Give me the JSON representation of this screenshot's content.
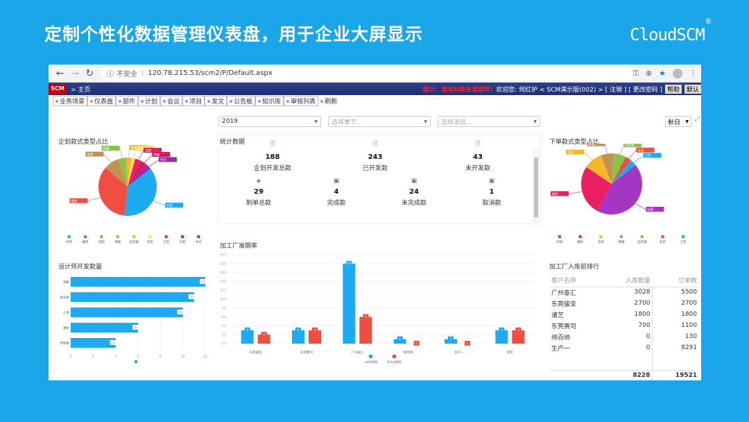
{
  "slide": {
    "title": "定制个性化数据管理仪表盘，用于企业大屏显示",
    "logo": "CloudSCM",
    "logo_mark": "®"
  },
  "browser": {
    "url_insecure": "不安全",
    "url": "120.78.215.53/scm2/P/Default.aspx"
  },
  "app": {
    "logo": "SCM",
    "breadcrumb": "> 主页",
    "warning": "提示：您有N条未读邮件!",
    "welcome": "欢迎您: 何红护 < SCM演示版(002) > [ 注销 ] [ 更改密码 ]",
    "btn_help": "帮助",
    "btn_default": "默认"
  },
  "tabs": [
    "业务场景",
    "仪表盘",
    "部件",
    "计划",
    "会议",
    "项目",
    "发文",
    "公告板",
    "知识库",
    "审核列表"
  ],
  "refresh": "刷新",
  "filters": {
    "year": "2019",
    "season_ph": "选择季节...",
    "wave_ph": "选择波段...",
    "season": "秋日"
  },
  "panels": {
    "plan": "企划款式类型占比",
    "stats": "统计数据",
    "order": "下单款式类型占比",
    "designer": "设计师开发款量",
    "factory": "加工厂准期率",
    "ranking": "加工厂入库前排行"
  },
  "stats": [
    {
      "icon": "🗎",
      "value": "188",
      "label": "企划开发总款"
    },
    {
      "icon": "🗎",
      "value": "243",
      "label": "已开发款"
    },
    {
      "icon": "🗎",
      "value": "43",
      "label": "未开发款"
    },
    {
      "icon": "◈",
      "value": "29",
      "label": "制单总款"
    },
    {
      "icon": "▣",
      "value": "4",
      "label": "完成款"
    },
    {
      "icon": "▣",
      "value": "24",
      "label": "未完成款"
    },
    {
      "icon": "▣",
      "value": "1",
      "label": "取消款"
    }
  ],
  "ranking": {
    "headers": [
      "客户名称",
      "入库数量",
      "订单数"
    ],
    "rows": [
      [
        "广州泰汇",
        "3028",
        "5500"
      ],
      [
        "东莞骏亚",
        "2700",
        "2700"
      ],
      [
        "诸艺",
        "1800",
        "1800"
      ],
      [
        "东莞赛司",
        "700",
        "1100"
      ],
      [
        "纳百纳",
        "0",
        "130"
      ],
      [
        "生产一",
        "0",
        "8291"
      ]
    ],
    "totals": [
      "",
      "8228",
      "19521"
    ]
  },
  "chart_data": [
    {
      "type": "pie",
      "title": "企划款式类型占比",
      "slices": [
        {
          "label": "针织",
          "value": 52,
          "color": "#1eaaf1"
        },
        {
          "label": "梭织",
          "value": 48,
          "color": "#f04d43"
        },
        {
          "label": "毛织",
          "value": 12,
          "color": "#c29254"
        },
        {
          "label": "棉服",
          "value": 6,
          "color": "#8bc34a"
        },
        {
          "label": "连衣裙",
          "value": 4,
          "color": "#f7b62a"
        },
        {
          "label": "毛衣",
          "value": 3,
          "color": "#f9d85c"
        },
        {
          "label": "卫衣",
          "value": 5,
          "color": "#e91e63"
        },
        {
          "label": "外套",
          "value": 5,
          "color": "#d81b60"
        },
        {
          "label": "牛仔",
          "value": 4,
          "color": "#9c27b0"
        }
      ]
    },
    {
      "type": "pie",
      "title": "下单款式类型占比",
      "slices": [
        {
          "label": "针织",
          "value": 13,
          "color": "#a536c2"
        },
        {
          "label": "梭织",
          "value": 8,
          "color": "#e91e63"
        },
        {
          "label": "毛织",
          "value": 3,
          "color": "#f7b62a"
        },
        {
          "label": "棉服",
          "value": 2,
          "color": "#c29254"
        },
        {
          "label": "连衣裙",
          "value": 2,
          "color": "#8bc34a"
        },
        {
          "label": "毛衣",
          "value": 1,
          "color": "#f04d43"
        },
        {
          "label": "卫衣",
          "value": 1,
          "color": "#1eaaf1"
        }
      ]
    },
    {
      "type": "bar",
      "orientation": "horizontal",
      "title": "设计师开发款量",
      "categories": [
        "梁彬",
        "张东彬",
        "小周",
        "潘松",
        "乔利娟"
      ],
      "values": [
        12,
        11,
        10,
        6,
        4
      ],
      "xlim": [
        0,
        12
      ],
      "color": "#1eaaf1"
    },
    {
      "type": "bar",
      "title": "加工厂准期率",
      "categories": [
        "东莞骏亚",
        "东莞赛司",
        "广州泰汇",
        "纳百纳",
        "生产一",
        "诸艺"
      ],
      "series": [
        {
          "name": "入库准期率",
          "values": [
            3,
            3,
            18,
            1,
            1,
            3
          ],
          "color": "#1eaaf1"
        },
        {
          "name": "到货准期率",
          "values": [
            2,
            3,
            6,
            0,
            0,
            3
          ],
          "color": "#f04d43"
        }
      ],
      "ylim": [
        0,
        20
      ]
    }
  ]
}
